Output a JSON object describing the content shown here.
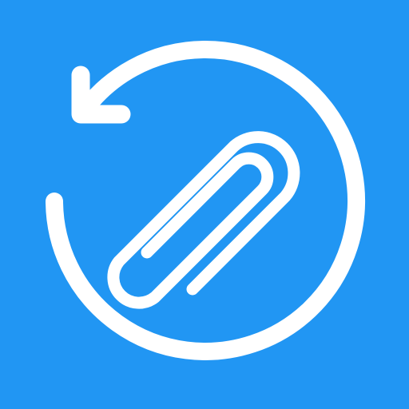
{
  "icon": {
    "name": "restore-attachment",
    "parts": [
      "undo-arrow-icon",
      "paperclip-icon"
    ],
    "colors": {
      "background": "#2196F3",
      "foreground": "#FFFFFF"
    }
  }
}
